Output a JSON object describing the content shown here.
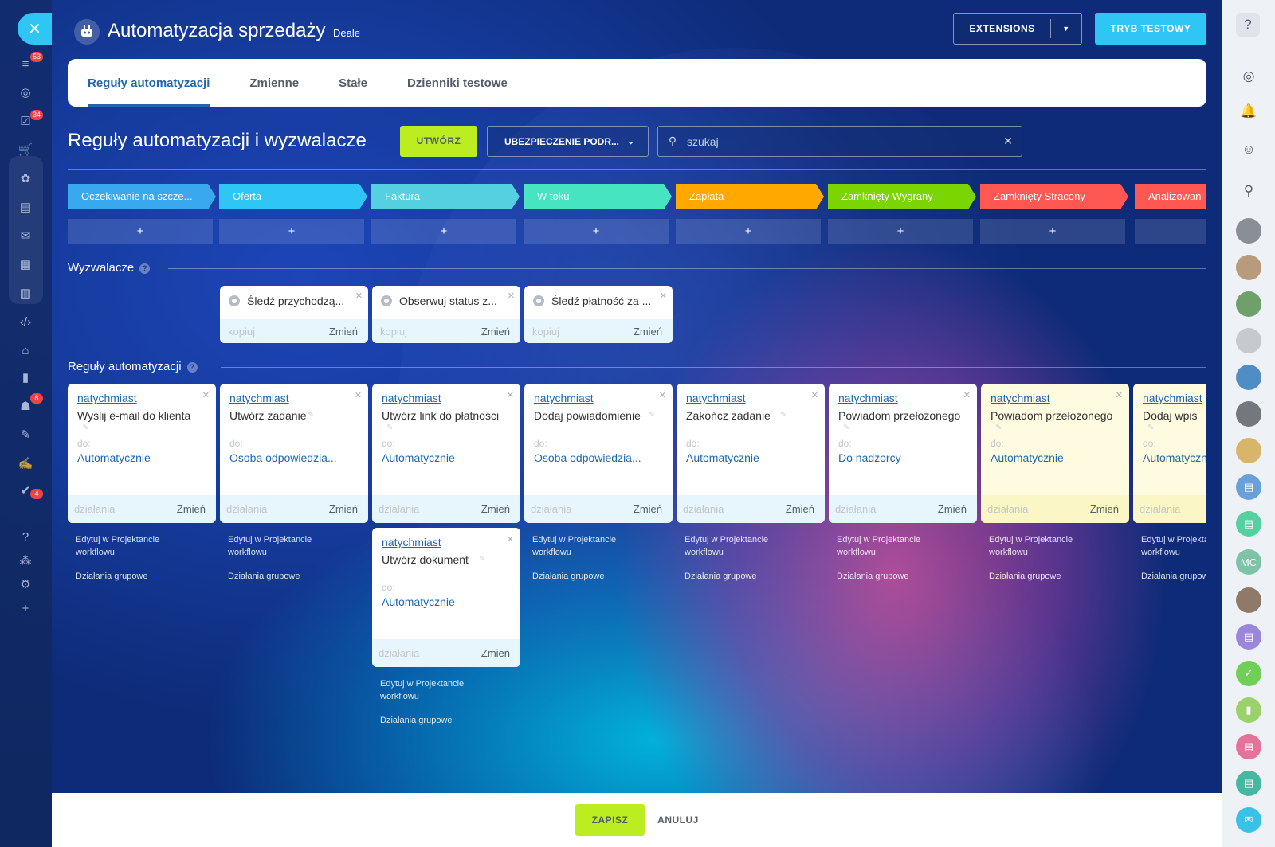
{
  "header": {
    "title": "Automatyzacja sprzedaży",
    "subtitle": "Deale",
    "extensions_label": "EXTENSIONS",
    "test_mode_label": "TRYB TESTOWY"
  },
  "tabs": [
    {
      "label": "Reguły automatyzacji",
      "active": true
    },
    {
      "label": "Zmienne",
      "active": false
    },
    {
      "label": "Stałe",
      "active": false
    },
    {
      "label": "Dzienniki testowe",
      "active": false
    }
  ],
  "toolbar": {
    "title": "Reguły automatyzacji i wyzwalacze",
    "create_label": "UTWÓRZ",
    "pipeline_label": "UBEZPIECZENIE PODR...",
    "search_placeholder": "szukaj"
  },
  "stages": [
    {
      "label": "Oczekiwanie na szcze...",
      "color": "#39a8ef",
      "add": "+"
    },
    {
      "label": "Oferta",
      "color": "#2fc6f6",
      "add": "+"
    },
    {
      "label": "Faktura",
      "color": "#55d0e0",
      "add": "+"
    },
    {
      "label": "W toku",
      "color": "#47e4c2",
      "add": "+"
    },
    {
      "label": "Zapłata",
      "color": "#ffa900",
      "add": "+"
    },
    {
      "label": "Zamknięty Wygrany",
      "color": "#7bd500",
      "add": "+"
    },
    {
      "label": "Zamknięty Stracony",
      "color": "#ff5752",
      "add": "+"
    },
    {
      "label": "Analizowan",
      "color": "#ff5752",
      "add": ""
    }
  ],
  "sections": {
    "triggers_label": "Wyzwalacze",
    "rules_label": "Reguły automatyzacji",
    "help": "?"
  },
  "triggers": [
    {
      "title": "Śledź przychodzą...",
      "copy": "kopiuj",
      "edit": "Zmień"
    },
    {
      "title": "Obserwuj status z...",
      "copy": "kopiuj",
      "edit": "Zmień"
    },
    {
      "title": "Śledź płatność za ...",
      "copy": "kopiuj",
      "edit": "Zmień"
    }
  ],
  "rules": [
    {
      "when": "natychmiast",
      "name": "Wyślij e-mail do klienta",
      "to": "do:",
      "target": "Automatycznie",
      "actions": "działania",
      "edit": "Zmień"
    },
    {
      "when": "natychmiast",
      "name": "Utwórz zadanie",
      "to": "do:",
      "target": "Osoba odpowiedzia...",
      "actions": "działania",
      "edit": "Zmień"
    },
    {
      "when": "natychmiast",
      "name": "Utwórz link do płatności",
      "to": "do:",
      "target": "Automatycznie",
      "actions": "działania",
      "edit": "Zmień"
    },
    {
      "when": "natychmiast",
      "name": "Dodaj powiadomienie",
      "to": "do:",
      "target": "Osoba odpowiedzia...",
      "actions": "działania",
      "edit": "Zmień"
    },
    {
      "when": "natychmiast",
      "name": "Zakończ zadanie",
      "to": "do:",
      "target": "Automatycznie",
      "actions": "działania",
      "edit": "Zmień"
    },
    {
      "when": "natychmiast",
      "name": "Powiadom przełożonego",
      "to": "do:",
      "target": "Do nadzorcy",
      "actions": "działania",
      "edit": "Zmień"
    },
    {
      "when": "natychmiast",
      "name": "Powiadom przełożonego",
      "to": "do:",
      "target": "Automatycznie",
      "actions": "działania",
      "edit": "Zmień"
    },
    {
      "when": "natychmiast",
      "name": "Dodaj wpis",
      "to": "do:",
      "target": "Automatycznie",
      "actions": "działania",
      "edit": ""
    },
    {
      "when": "natychmiast",
      "name": "Utwórz dokument",
      "to": "do:",
      "target": "Automatycznie",
      "actions": "działania",
      "edit": "Zmień"
    }
  ],
  "column_links": {
    "edit_workflow": "Edytuj w Projektancie workflowu",
    "group_actions": "Działania grupowe"
  },
  "left_sidebar": {
    "badges": [
      "53",
      "34",
      "8",
      "4"
    ]
  },
  "right_sidebar": {
    "mc_avatar": "MC"
  },
  "footer": {
    "save_label": "ZAPISZ",
    "cancel_label": "ANULUJ"
  }
}
